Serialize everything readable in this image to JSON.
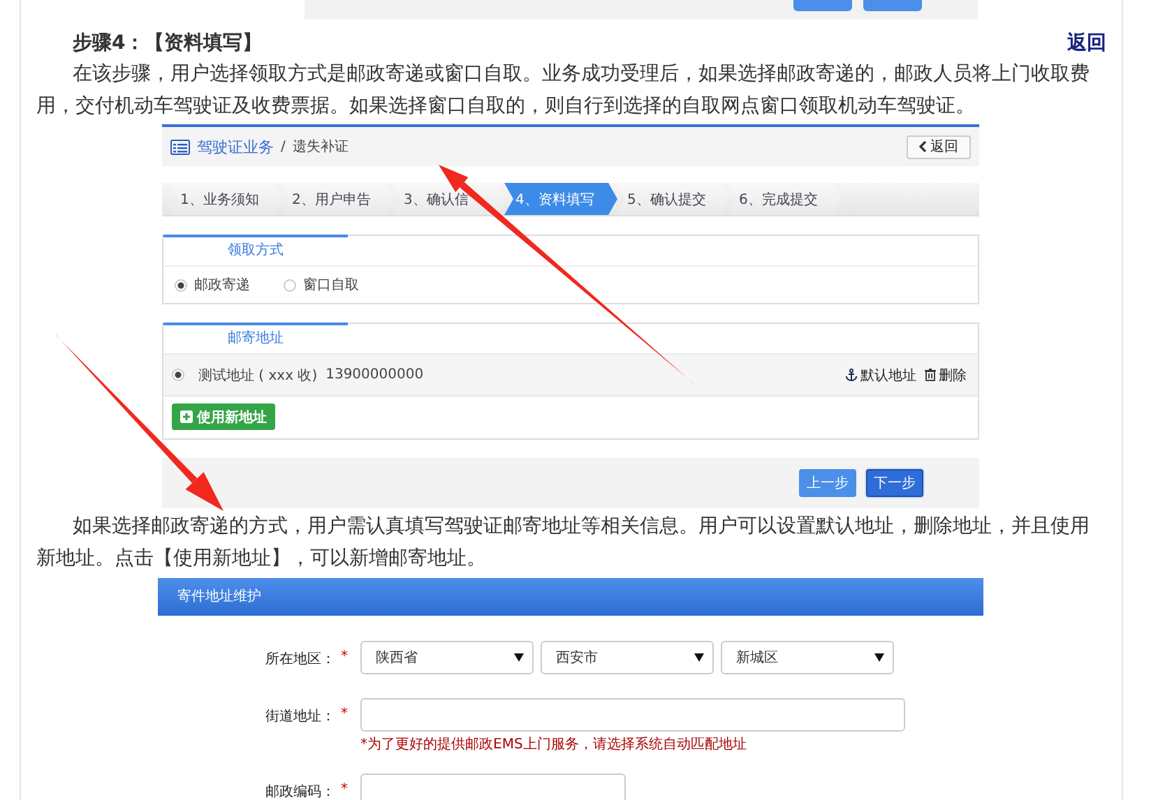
{
  "previous_figure": {
    "kind": "cropped_screenshot"
  },
  "step": {
    "title": "步骤4：【资料填写】",
    "back_link": "返回"
  },
  "intro_paragraph": "在该步骤，用户选择领取方式是邮政寄递或窗口自取。业务成功受理后，如果选择邮政寄递的，邮政人员将上门收取费用，交付机动车驾驶证及收费票据。如果选择窗口自取的，则自行到选择的自取网点窗口领取机动车驾驶证。",
  "app_screenshot": {
    "breadcrumb": {
      "section": "驾驶证业务",
      "separator": "/",
      "page": "遗失补证"
    },
    "back_button": "返回",
    "steps": [
      {
        "label": "1、业务须知",
        "selected": false
      },
      {
        "label": "2、用户申告",
        "selected": false
      },
      {
        "label": "3、确认信",
        "selected": false
      },
      {
        "label": "4、资料填写",
        "selected": true
      },
      {
        "label": "5、确认提交",
        "selected": false
      },
      {
        "label": "6、完成提交",
        "selected": false
      }
    ],
    "pickup": {
      "tab": "领取方式",
      "options": [
        {
          "label": "邮政寄递",
          "selected": true
        },
        {
          "label": "窗口自取",
          "selected": false
        }
      ]
    },
    "address": {
      "tab": "邮寄地址",
      "rows": [
        {
          "text": "测试地址 ( xxx 收)",
          "phone": "13900000000",
          "selected": true,
          "default_action": "默认地址",
          "delete_action": "删除"
        }
      ],
      "add_button": "使用新地址"
    },
    "footer_buttons": [
      {
        "label": "上一步",
        "kind": "secondary"
      },
      {
        "label": "下一步",
        "kind": "primary"
      }
    ]
  },
  "second_paragraph": "如果选择邮政寄递的方式，用户需认真填写驾驶证邮寄地址等相关信息。用户可以设置默认地址，删除地址，并且使用新地址。点击【使用新地址】，可以新增邮寄地址。",
  "address_form": {
    "title": "寄件地址维护",
    "fields": [
      {
        "label": "所在地区：",
        "mark": "*",
        "kind": "selects",
        "selects": [
          "陕西省",
          "西安市",
          "新城区"
        ]
      },
      {
        "label": "街道地址：",
        "mark": "*",
        "kind": "text",
        "hint": "*为了更好的提供邮政EMS上门服务，请选择系统自动匹配地址"
      },
      {
        "label": "邮政编码：",
        "mark": "*",
        "kind": "short_text"
      }
    ]
  },
  "arrows": [
    {
      "kind": "arrow"
    },
    {
      "kind": "arrow"
    }
  ]
}
